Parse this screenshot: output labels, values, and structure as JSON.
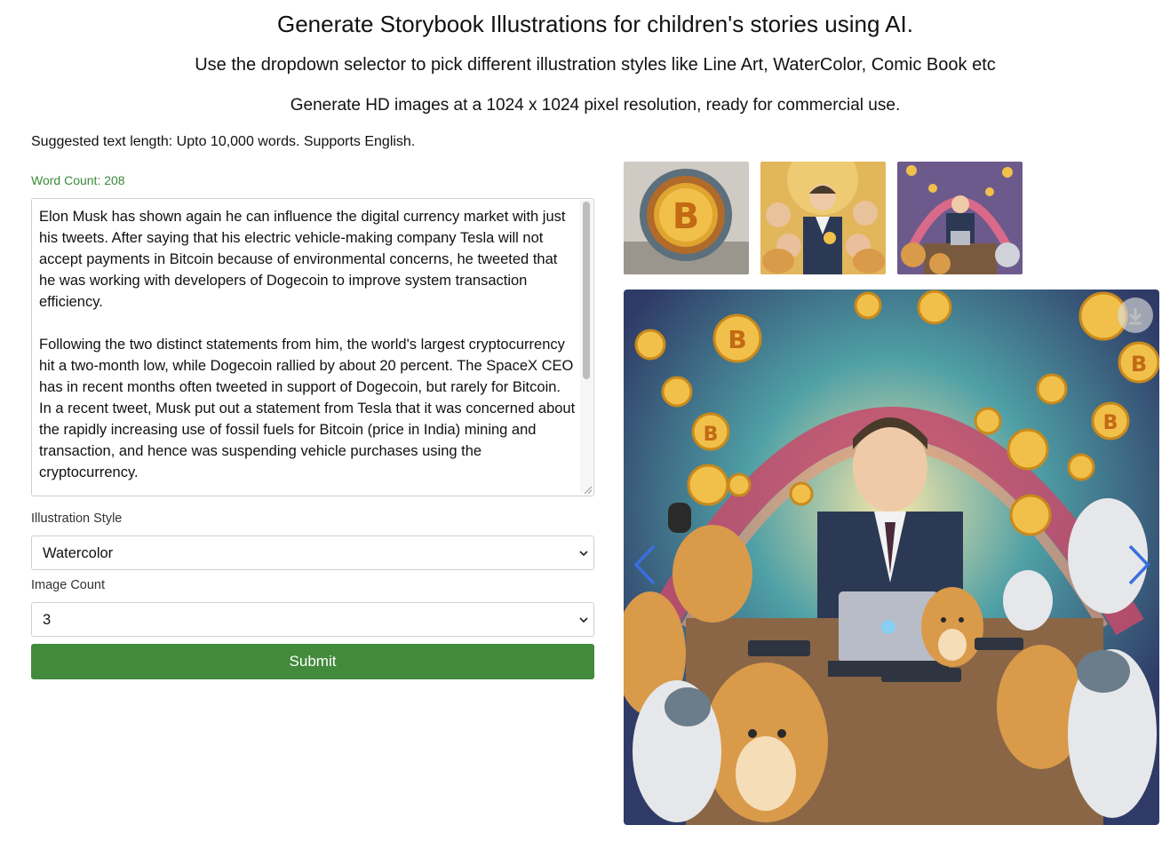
{
  "header": {
    "title": "Generate Storybook Illustrations for children's stories using AI.",
    "subtitle": "Use the dropdown selector to pick different illustration styles like Line Art, WaterColor, Comic Book etc",
    "resolution_note": "Generate HD images at a 1024 x 1024 pixel resolution, ready for commercial use."
  },
  "form": {
    "suggestion": "Suggested text length: Upto 10,000 words. Supports English.",
    "word_count": "Word Count: 208",
    "story_text": "Elon Musk has shown again he can influence the digital currency market with just his tweets. After saying that his electric vehicle-making company Tesla will not accept payments in Bitcoin because of environmental concerns, he tweeted that he was working with developers of Dogecoin to improve system transaction efficiency.\n\nFollowing the two distinct statements from him, the world's largest cryptocurrency hit a two-month low, while Dogecoin rallied by about 20 percent. The SpaceX CEO has in recent months often tweeted in support of Dogecoin, but rarely for Bitcoin.  In a recent tweet, Musk put out a statement from Tesla that it was concerned about the rapidly increasing use of fossil fuels for Bitcoin (price in India) mining and transaction, and hence was suspending vehicle purchases using the cryptocurrency.",
    "style_label": "Illustration Style",
    "style_value": "Watercolor",
    "count_label": "Image Count",
    "count_value": "3",
    "submit_label": "Submit"
  },
  "gallery": {
    "thumbnails": [
      "bitcoin-coin-illustration",
      "man-with-children-and-dogs-illustration",
      "man-at-laptop-with-dogs-illustration"
    ],
    "main_image": "man-at-laptop-with-shiba-dogs-and-coins-illustration",
    "icons": {
      "download": "download-icon",
      "prev": "chevron-left-icon",
      "next": "chevron-right-icon"
    }
  },
  "colors": {
    "accent_green": "#428a3c",
    "word_count_green": "#3a8a3a",
    "nav_arrow_blue": "#3a6fe0"
  }
}
